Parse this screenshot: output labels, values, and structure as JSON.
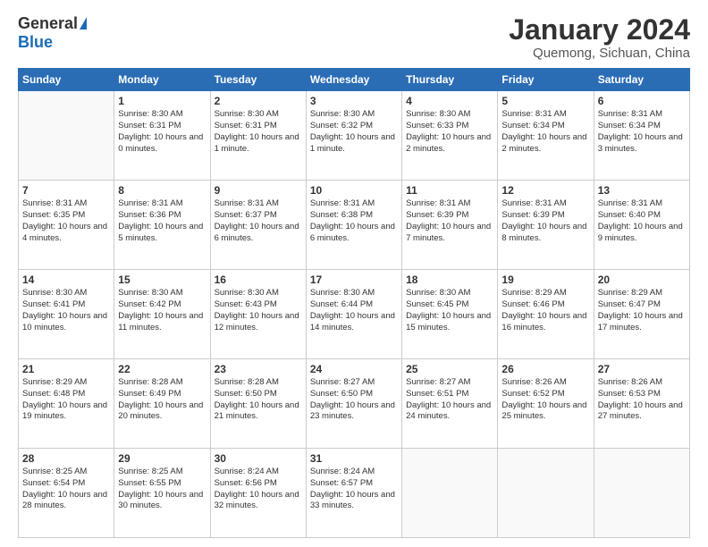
{
  "header": {
    "logo_general": "General",
    "logo_blue": "Blue",
    "month_title": "January 2024",
    "location": "Quemong, Sichuan, China"
  },
  "days_of_week": [
    "Sunday",
    "Monday",
    "Tuesday",
    "Wednesday",
    "Thursday",
    "Friday",
    "Saturday"
  ],
  "weeks": [
    [
      {
        "day": "",
        "sunrise": "",
        "sunset": "",
        "daylight": ""
      },
      {
        "day": "1",
        "sunrise": "Sunrise: 8:30 AM",
        "sunset": "Sunset: 6:31 PM",
        "daylight": "Daylight: 10 hours and 0 minutes."
      },
      {
        "day": "2",
        "sunrise": "Sunrise: 8:30 AM",
        "sunset": "Sunset: 6:31 PM",
        "daylight": "Daylight: 10 hours and 1 minute."
      },
      {
        "day": "3",
        "sunrise": "Sunrise: 8:30 AM",
        "sunset": "Sunset: 6:32 PM",
        "daylight": "Daylight: 10 hours and 1 minute."
      },
      {
        "day": "4",
        "sunrise": "Sunrise: 8:30 AM",
        "sunset": "Sunset: 6:33 PM",
        "daylight": "Daylight: 10 hours and 2 minutes."
      },
      {
        "day": "5",
        "sunrise": "Sunrise: 8:31 AM",
        "sunset": "Sunset: 6:34 PM",
        "daylight": "Daylight: 10 hours and 2 minutes."
      },
      {
        "day": "6",
        "sunrise": "Sunrise: 8:31 AM",
        "sunset": "Sunset: 6:34 PM",
        "daylight": "Daylight: 10 hours and 3 minutes."
      }
    ],
    [
      {
        "day": "7",
        "sunrise": "Sunrise: 8:31 AM",
        "sunset": "Sunset: 6:35 PM",
        "daylight": "Daylight: 10 hours and 4 minutes."
      },
      {
        "day": "8",
        "sunrise": "Sunrise: 8:31 AM",
        "sunset": "Sunset: 6:36 PM",
        "daylight": "Daylight: 10 hours and 5 minutes."
      },
      {
        "day": "9",
        "sunrise": "Sunrise: 8:31 AM",
        "sunset": "Sunset: 6:37 PM",
        "daylight": "Daylight: 10 hours and 6 minutes."
      },
      {
        "day": "10",
        "sunrise": "Sunrise: 8:31 AM",
        "sunset": "Sunset: 6:38 PM",
        "daylight": "Daylight: 10 hours and 6 minutes."
      },
      {
        "day": "11",
        "sunrise": "Sunrise: 8:31 AM",
        "sunset": "Sunset: 6:39 PM",
        "daylight": "Daylight: 10 hours and 7 minutes."
      },
      {
        "day": "12",
        "sunrise": "Sunrise: 8:31 AM",
        "sunset": "Sunset: 6:39 PM",
        "daylight": "Daylight: 10 hours and 8 minutes."
      },
      {
        "day": "13",
        "sunrise": "Sunrise: 8:31 AM",
        "sunset": "Sunset: 6:40 PM",
        "daylight": "Daylight: 10 hours and 9 minutes."
      }
    ],
    [
      {
        "day": "14",
        "sunrise": "Sunrise: 8:30 AM",
        "sunset": "Sunset: 6:41 PM",
        "daylight": "Daylight: 10 hours and 10 minutes."
      },
      {
        "day": "15",
        "sunrise": "Sunrise: 8:30 AM",
        "sunset": "Sunset: 6:42 PM",
        "daylight": "Daylight: 10 hours and 11 minutes."
      },
      {
        "day": "16",
        "sunrise": "Sunrise: 8:30 AM",
        "sunset": "Sunset: 6:43 PM",
        "daylight": "Daylight: 10 hours and 12 minutes."
      },
      {
        "day": "17",
        "sunrise": "Sunrise: 8:30 AM",
        "sunset": "Sunset: 6:44 PM",
        "daylight": "Daylight: 10 hours and 14 minutes."
      },
      {
        "day": "18",
        "sunrise": "Sunrise: 8:30 AM",
        "sunset": "Sunset: 6:45 PM",
        "daylight": "Daylight: 10 hours and 15 minutes."
      },
      {
        "day": "19",
        "sunrise": "Sunrise: 8:29 AM",
        "sunset": "Sunset: 6:46 PM",
        "daylight": "Daylight: 10 hours and 16 minutes."
      },
      {
        "day": "20",
        "sunrise": "Sunrise: 8:29 AM",
        "sunset": "Sunset: 6:47 PM",
        "daylight": "Daylight: 10 hours and 17 minutes."
      }
    ],
    [
      {
        "day": "21",
        "sunrise": "Sunrise: 8:29 AM",
        "sunset": "Sunset: 6:48 PM",
        "daylight": "Daylight: 10 hours and 19 minutes."
      },
      {
        "day": "22",
        "sunrise": "Sunrise: 8:28 AM",
        "sunset": "Sunset: 6:49 PM",
        "daylight": "Daylight: 10 hours and 20 minutes."
      },
      {
        "day": "23",
        "sunrise": "Sunrise: 8:28 AM",
        "sunset": "Sunset: 6:50 PM",
        "daylight": "Daylight: 10 hours and 21 minutes."
      },
      {
        "day": "24",
        "sunrise": "Sunrise: 8:27 AM",
        "sunset": "Sunset: 6:50 PM",
        "daylight": "Daylight: 10 hours and 23 minutes."
      },
      {
        "day": "25",
        "sunrise": "Sunrise: 8:27 AM",
        "sunset": "Sunset: 6:51 PM",
        "daylight": "Daylight: 10 hours and 24 minutes."
      },
      {
        "day": "26",
        "sunrise": "Sunrise: 8:26 AM",
        "sunset": "Sunset: 6:52 PM",
        "daylight": "Daylight: 10 hours and 25 minutes."
      },
      {
        "day": "27",
        "sunrise": "Sunrise: 8:26 AM",
        "sunset": "Sunset: 6:53 PM",
        "daylight": "Daylight: 10 hours and 27 minutes."
      }
    ],
    [
      {
        "day": "28",
        "sunrise": "Sunrise: 8:25 AM",
        "sunset": "Sunset: 6:54 PM",
        "daylight": "Daylight: 10 hours and 28 minutes."
      },
      {
        "day": "29",
        "sunrise": "Sunrise: 8:25 AM",
        "sunset": "Sunset: 6:55 PM",
        "daylight": "Daylight: 10 hours and 30 minutes."
      },
      {
        "day": "30",
        "sunrise": "Sunrise: 8:24 AM",
        "sunset": "Sunset: 6:56 PM",
        "daylight": "Daylight: 10 hours and 32 minutes."
      },
      {
        "day": "31",
        "sunrise": "Sunrise: 8:24 AM",
        "sunset": "Sunset: 6:57 PM",
        "daylight": "Daylight: 10 hours and 33 minutes."
      },
      {
        "day": "",
        "sunrise": "",
        "sunset": "",
        "daylight": ""
      },
      {
        "day": "",
        "sunrise": "",
        "sunset": "",
        "daylight": ""
      },
      {
        "day": "",
        "sunrise": "",
        "sunset": "",
        "daylight": ""
      }
    ]
  ]
}
